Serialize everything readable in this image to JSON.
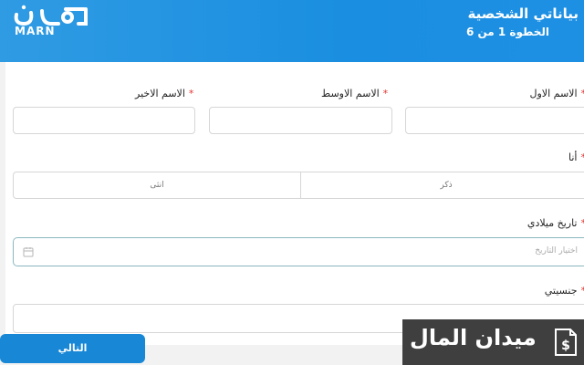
{
  "header": {
    "logo_arabic": "مرن",
    "logo_latin": "MARN",
    "title": "بياناتي الشخصية",
    "step": "الخطوة 1 من 6"
  },
  "form": {
    "first_name_label": "الاسم الاول",
    "middle_name_label": "الاسم الاوسط",
    "last_name_label": "الاسم الاخير",
    "required_mark": "*",
    "gender_label": "أنا",
    "gender_options": [
      "ذكر",
      "انثى"
    ],
    "dob_label": "تاريخ ميلادي",
    "dob_placeholder": "اختيار التاريخ",
    "nationality_label": "جنسيتي"
  },
  "footer": {
    "next_label": "التالي"
  },
  "watermark": {
    "text": "ميدان المال"
  },
  "colors": {
    "header_blue": "#1e90e4",
    "button_blue": "#1787d6",
    "required_red": "#e3342f"
  }
}
